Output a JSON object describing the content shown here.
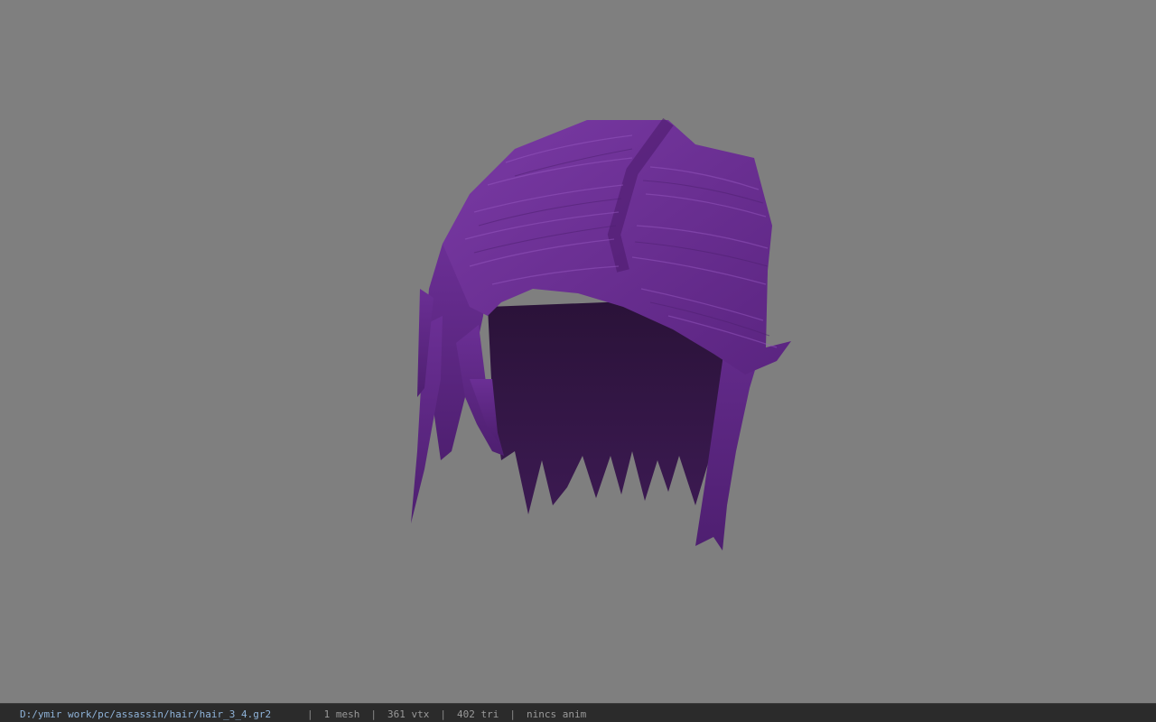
{
  "viewer": {
    "background_color": "#7f7f7f",
    "model_name": "hair model",
    "hair_color": "#6a2f8f"
  },
  "status": {
    "file_path": "D:/ymir work/pc/assassin/hair/hair_3_4.gr2",
    "meshes": "1 mesh",
    "vertices": "361 vtx",
    "triangles": "402 tri",
    "animation": "nincs anim",
    "separator": "|"
  }
}
